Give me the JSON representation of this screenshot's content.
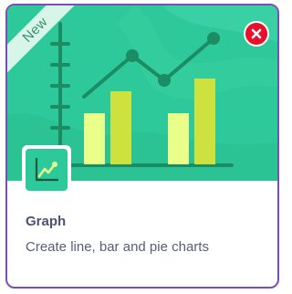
{
  "card": {
    "badge": "New",
    "title": "Graph",
    "description": "Create line, bar and pie charts"
  },
  "icons": {
    "close": "close-icon",
    "app": "line-chart-icon"
  },
  "colors": {
    "banner": "#2ec99a",
    "border": "#7a4fb3",
    "close": "#e8102b",
    "bar_light": "#eaff8a",
    "bar_dark": "#cde23e",
    "line": "#1b8c63"
  }
}
